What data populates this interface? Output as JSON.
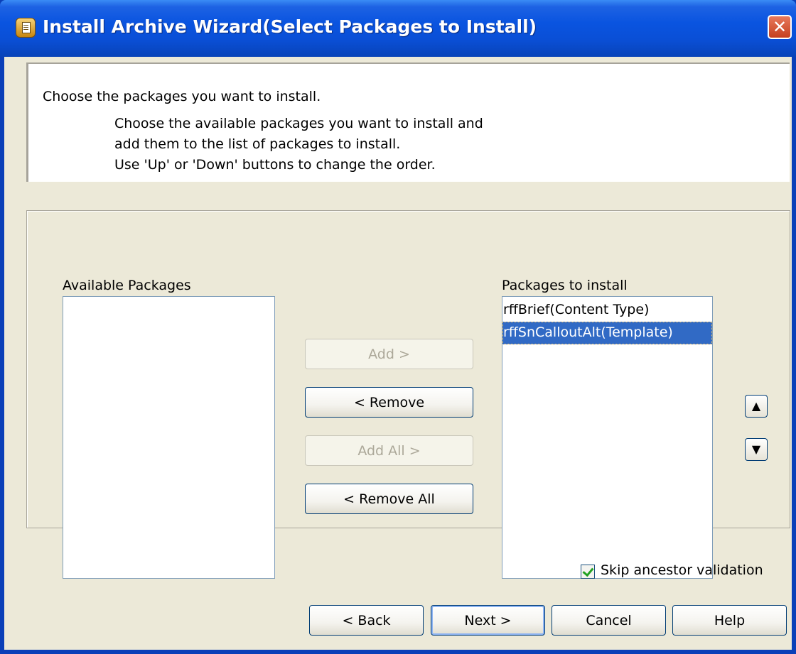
{
  "window": {
    "title": "Install Archive Wizard(Select Packages to Install)",
    "close_glyph": "✕"
  },
  "header": {
    "main": "Choose the packages you want to install.",
    "lines": [
      "Choose the available packages you want to install and",
      "add them to the list of packages to install.",
      "Use 'Up' or 'Down' buttons to change the order."
    ]
  },
  "available": {
    "label": "Available Packages",
    "items": []
  },
  "to_install": {
    "label": "Packages to install",
    "items": [
      "rffBrief(Content Type)",
      "rffSnCalloutAlt(Template)"
    ],
    "selected_index": 1
  },
  "buttons": {
    "add": "Add >",
    "remove": "< Remove",
    "add_all": "Add All >",
    "remove_all": "< Remove All",
    "up_glyph": "▲",
    "down_glyph": "▼",
    "back": "< Back",
    "next": "Next >",
    "cancel": "Cancel",
    "help": "Help"
  },
  "options": {
    "skip_ancestor_validation_label": "Skip ancestor validation",
    "skip_ancestor_validation_checked": true
  },
  "colors": {
    "titlebar": "#0a54e0",
    "selection": "#316ac5",
    "dialog_bg": "#ece9d8"
  }
}
